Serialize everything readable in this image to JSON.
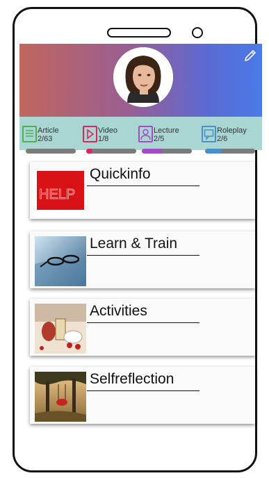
{
  "colors": {
    "article": "#4caf50",
    "video": "#e0245e",
    "lecture": "#a24bc7",
    "roleplay": "#4a90c8",
    "bar_track": "#7b7b7b",
    "stats_bg": "#a9d6d3"
  },
  "header": {
    "avatar_icon": "avatar-portrait",
    "edit_icon": "pencil-icon"
  },
  "stats": [
    {
      "label": "Article",
      "count": "2/63",
      "progress": 0.032,
      "icon": "article-icon"
    },
    {
      "label": "Video",
      "count": "1/8",
      "progress": 0.125,
      "icon": "video-play-icon"
    },
    {
      "label": "Lecture",
      "count": "2/5",
      "progress": 0.4,
      "icon": "person-icon"
    },
    {
      "label": "Roleplay",
      "count": "2/6",
      "progress": 0.333,
      "icon": "roleplay-icon"
    }
  ],
  "cards": [
    {
      "title": "Quickinfo",
      "thumb_text": "HELP"
    },
    {
      "title": "Learn & Train"
    },
    {
      "title": "Activities"
    },
    {
      "title": "Selfreflection"
    }
  ]
}
